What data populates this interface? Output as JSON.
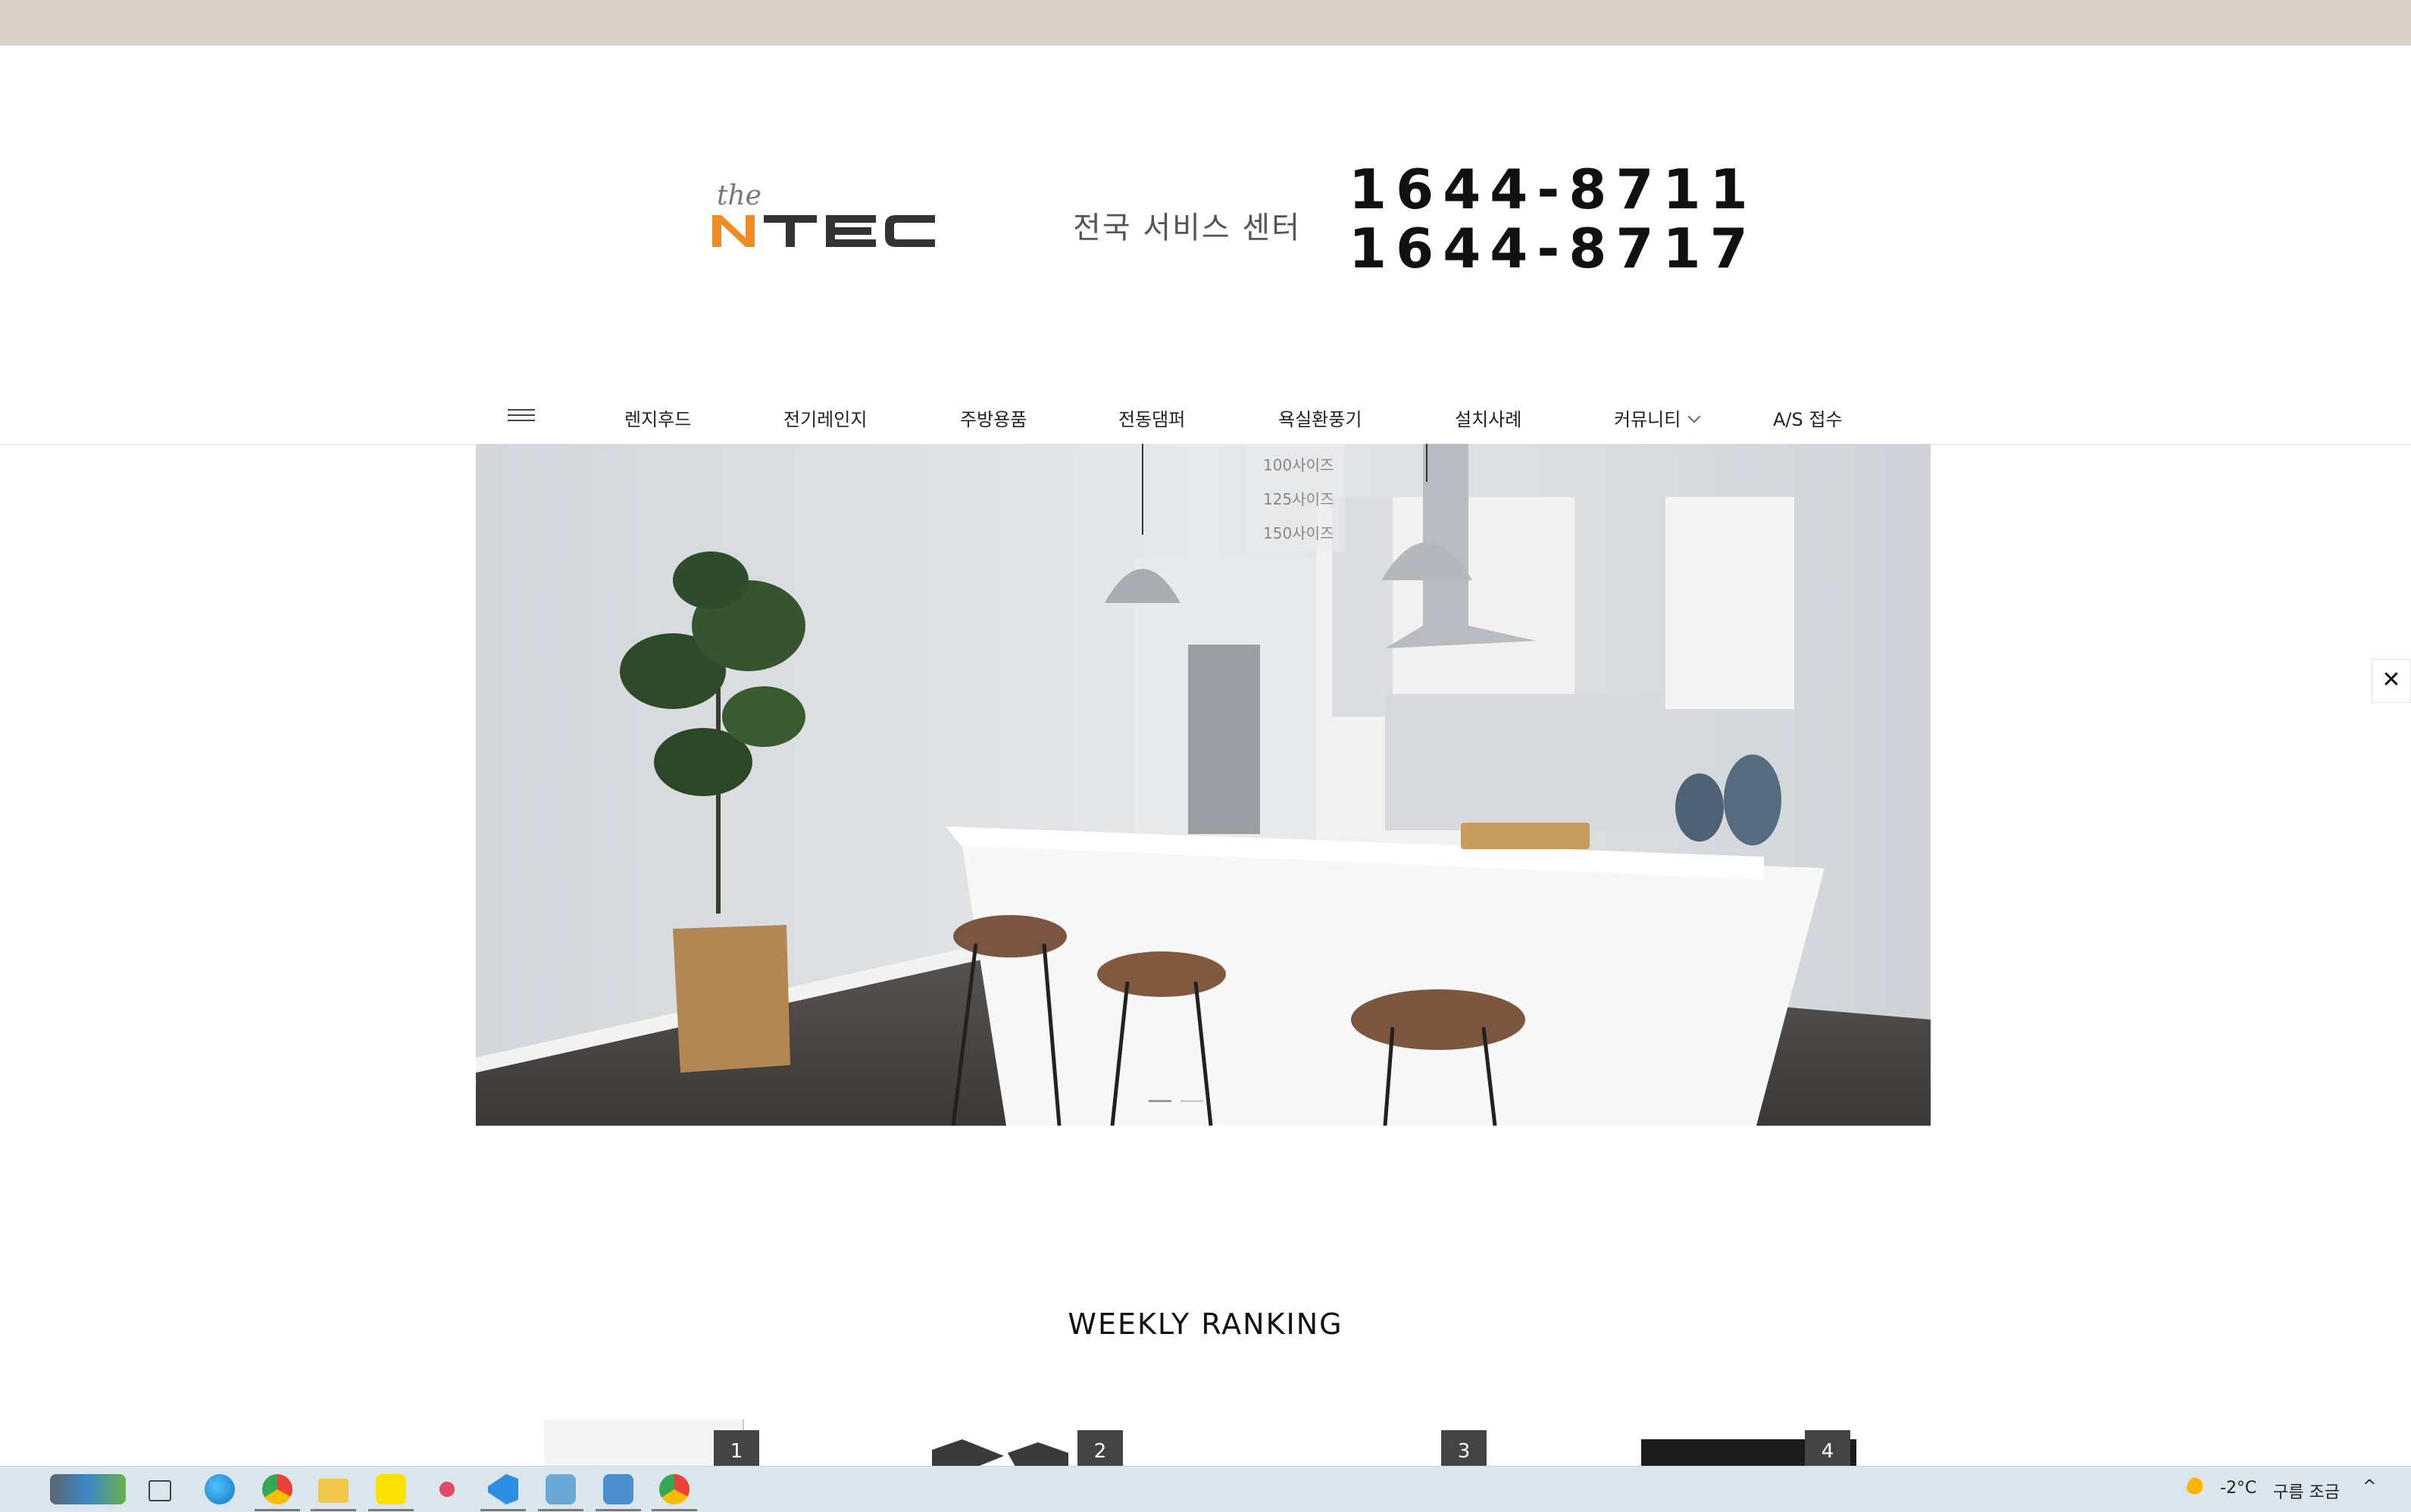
{
  "header": {
    "logo_the": "the",
    "logo_main": "NTEC",
    "service_label": "전국 서비스 센터",
    "phones": [
      "1644-8711",
      "1644-8717"
    ]
  },
  "nav": {
    "menu_icon": "hamburger-menu-icon",
    "items": [
      {
        "label": "렌지후드"
      },
      {
        "label": "전기레인지"
      },
      {
        "label": "주방용품"
      },
      {
        "label": "전동댐퍼"
      },
      {
        "label": "욕실환풍기"
      },
      {
        "label": "설치사례"
      },
      {
        "label": "커뮤니티"
      },
      {
        "label": "A/S 접수"
      }
    ],
    "dropdown": [
      "100사이즈",
      "125사이즈",
      "150사이즈"
    ]
  },
  "close_label": "✕",
  "ranking": {
    "title": "WEEKLY RANKING",
    "badges": [
      "1",
      "2",
      "3",
      "4"
    ]
  },
  "taskbar": {
    "weather_temp": "-2°C",
    "weather_desc": "구름 조금",
    "icons": [
      "widget-icon",
      "task-view-icon",
      "edge-icon",
      "chrome-icon",
      "file-explorer-icon",
      "kakaotalk-icon",
      "snipping-tool-icon",
      "vscode-icon",
      "app-icon",
      "app-icon-2",
      "chrome-profile-icon"
    ]
  },
  "colors": {
    "topbar": "#d8d0c6",
    "logo_orange": "#f08a24",
    "logo_dark": "#333333",
    "taskbar": "#dbe6ec"
  }
}
